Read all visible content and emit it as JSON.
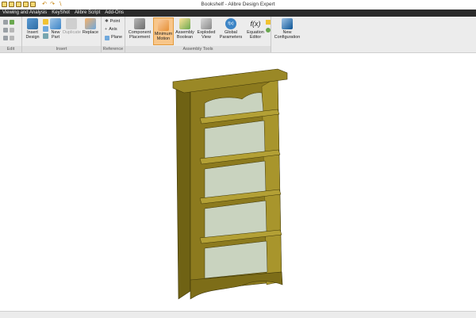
{
  "window": {
    "title": "Bookshelf - Alibre Design Expert"
  },
  "menu": [
    "Viewing and Analysis",
    "KeyShot",
    "Alibre Script",
    "Add-Ons"
  ],
  "groups": {
    "edit": "Edit",
    "insert": "Insert",
    "reference": "Reference",
    "assembly_tools": "Assembly Tools"
  },
  "buttons": {
    "insert_design": [
      "Insert",
      "Design"
    ],
    "new_part": [
      "New",
      "Part"
    ],
    "duplicate": "Duplicate",
    "replace": "Replace",
    "point": "Point",
    "axis": "Axis",
    "plane": "Plane",
    "component_placement": [
      "Component",
      "Placement"
    ],
    "minimum_motion": [
      "Minimum",
      "Motion"
    ],
    "assembly_boolean": [
      "Assembly",
      "Boolean"
    ],
    "exploded_view": [
      "Exploded",
      "View"
    ],
    "global_parameters": [
      "Global",
      "Parameters"
    ],
    "equation_editor": [
      "Equation",
      "Editor"
    ],
    "new_configuration": [
      "New",
      "Configuration"
    ]
  },
  "icons": {
    "global_parameters": "f(x)",
    "equation_editor": "f(x)"
  },
  "colors": {
    "menubar": "#2b2b2b",
    "ribbon": "#ececec",
    "active_button": "#f8c68a",
    "model_wood": "#8c7a1e",
    "model_panel": "#c9d3bf"
  },
  "viewport": {
    "model": "Bookshelf 3D model"
  }
}
